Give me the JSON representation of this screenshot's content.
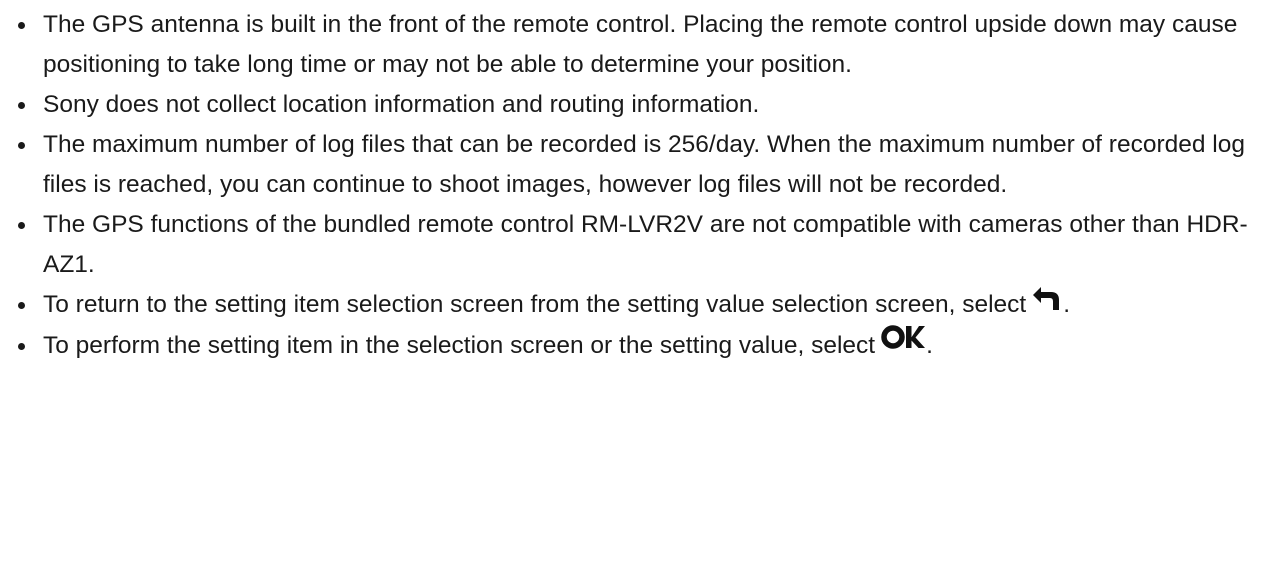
{
  "notes": [
    {
      "text": "The GPS antenna is built in the front of the remote control. Placing the remote control upside down may cause positioning to take long time or may not be able to determine your position."
    },
    {
      "text": "Sony does not collect location information and routing information."
    },
    {
      "text": "The maximum number of log files that can be recorded is 256/day. When the maximum number of recorded log files is reached, you can continue to shoot images, however log files will not be recorded."
    },
    {
      "text": "The GPS functions of the bundled remote control RM-LVR2V are not compatible with cameras other than HDR-AZ1."
    },
    {
      "text_before": "To return to the setting item selection screen from the setting value selection screen, select",
      "icon": "return-arrow-icon",
      "text_after": "."
    },
    {
      "text_before": "To perform the setting item in the selection screen or the setting value, select",
      "icon": "ok-icon",
      "text_after": "."
    }
  ]
}
